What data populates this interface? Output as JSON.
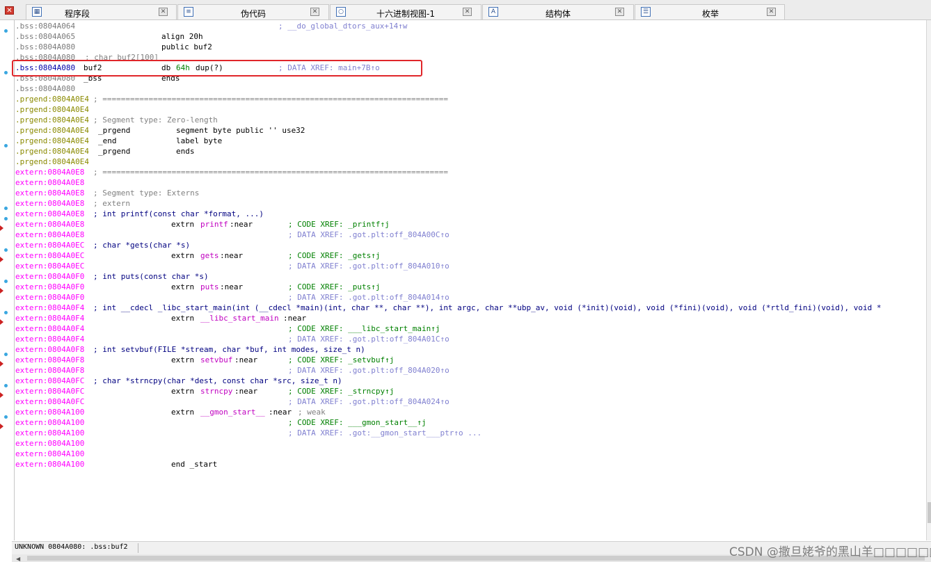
{
  "tabs": [
    {
      "label": "程序段",
      "icon": "program-segment-icon"
    },
    {
      "label": "伪代码",
      "icon": "pseudocode-icon"
    },
    {
      "label": "十六进制视图-1",
      "icon": "hex-view-icon"
    },
    {
      "label": "结构体",
      "icon": "structures-icon"
    },
    {
      "label": "枚举",
      "icon": "enums-icon"
    }
  ],
  "lines": [
    {
      "seg": "bss",
      "addr": ".bss:0804A064",
      "parts": [
        {
          "t": "; __do_global_dtors_aux+14↑w",
          "cls": "cmt-b",
          "col": 378
        }
      ]
    },
    {
      "seg": "bss",
      "addr": ".bss:0804A065",
      "parts": [
        {
          "t": "align 20h",
          "cls": "blk2",
          "col": 210
        }
      ]
    },
    {
      "seg": "bss",
      "addr": ".bss:0804A080",
      "parts": [
        {
          "t": "public buf2",
          "cls": "blk2",
          "col": 210
        }
      ]
    },
    {
      "seg": "bss",
      "addr": ".bss:0804A080",
      "parts": [
        {
          "t": "; char buf2[100]",
          "cls": "cmt",
          "col": 100
        }
      ]
    },
    {
      "seg": "bss-hl",
      "addr": ".bss:0804A080",
      "parts": [
        {
          "t": "buf2",
          "cls": "blk2",
          "col": 98
        },
        {
          "t": "db",
          "cls": "blk2",
          "col": 210
        },
        {
          "t": "64h",
          "cls": "num",
          "col": 231
        },
        {
          "t": "dup(?)",
          "cls": "blk2",
          "col": 259
        },
        {
          "t": "; DATA XREF: main+7B↑o",
          "cls": "cmt-b",
          "col": 378
        }
      ]
    },
    {
      "seg": "bss",
      "addr": ".bss:0804A080",
      "parts": [
        {
          "t": "_bss",
          "cls": "blk2",
          "col": 98
        },
        {
          "t": "ends",
          "cls": "blk2",
          "col": 210
        }
      ]
    },
    {
      "seg": "bss",
      "addr": ".bss:0804A080",
      "parts": []
    },
    {
      "seg": "prg",
      "addr": ".prgend:0804A0E4",
      "parts": [
        {
          "t": "; ===========================================================================",
          "cls": "cmt",
          "col": 112
        }
      ]
    },
    {
      "seg": "prg",
      "addr": ".prgend:0804A0E4",
      "parts": []
    },
    {
      "seg": "prg",
      "addr": ".prgend:0804A0E4",
      "parts": [
        {
          "t": "; Segment type: Zero-length",
          "cls": "cmt",
          "col": 112
        }
      ]
    },
    {
      "seg": "prg",
      "addr": ".prgend:0804A0E4",
      "parts": [
        {
          "t": "_prgend",
          "cls": "blk2",
          "col": 119
        },
        {
          "t": "segment byte public '' use32",
          "cls": "blk2",
          "col": 231
        }
      ]
    },
    {
      "seg": "prg",
      "addr": ".prgend:0804A0E4",
      "parts": [
        {
          "t": "_end",
          "cls": "blk2",
          "col": 119
        },
        {
          "t": "label byte",
          "cls": "blk2",
          "col": 231
        }
      ]
    },
    {
      "seg": "prg",
      "addr": ".prgend:0804A0E4",
      "parts": [
        {
          "t": "_prgend",
          "cls": "blk2",
          "col": 119
        },
        {
          "t": "ends",
          "cls": "blk2",
          "col": 231
        }
      ]
    },
    {
      "seg": "prg",
      "addr": ".prgend:0804A0E4",
      "parts": []
    },
    {
      "seg": "ext",
      "addr": "extern:0804A0E8",
      "parts": [
        {
          "t": "; ===========================================================================",
          "cls": "cmt",
          "col": 112
        }
      ]
    },
    {
      "seg": "ext",
      "addr": "extern:0804A0E8",
      "parts": []
    },
    {
      "seg": "ext",
      "addr": "extern:0804A0E8",
      "parts": [
        {
          "t": "; Segment type: Externs",
          "cls": "cmt",
          "col": 112
        }
      ]
    },
    {
      "seg": "ext",
      "addr": "extern:0804A0E8",
      "parts": [
        {
          "t": "; extern",
          "cls": "cmt",
          "col": 112
        }
      ]
    },
    {
      "seg": "ext",
      "addr": "extern:0804A0E8",
      "parts": [
        {
          "t": "; int printf(const char *format, ...)",
          "cls": "sig",
          "col": 112
        }
      ]
    },
    {
      "seg": "ext",
      "addr": "extern:0804A0E8",
      "parts": [
        {
          "t": "extrn",
          "cls": "blk2",
          "col": 224
        },
        {
          "t": "printf",
          "cls": "fnp",
          "col": 266
        },
        {
          "t": ":near",
          "cls": "blk2",
          "col": 308
        },
        {
          "t": "; CODE XREF: _printf↑j",
          "cls": "code-x",
          "col": 392
        }
      ]
    },
    {
      "seg": "ext",
      "addr": "extern:0804A0E8",
      "parts": [
        {
          "t": "; DATA XREF: .got.plt:off_804A00C↑o",
          "cls": "cmt-b",
          "col": 392
        }
      ]
    },
    {
      "seg": "ext",
      "addr": "extern:0804A0EC",
      "parts": [
        {
          "t": "; char *gets(char *s)",
          "cls": "sig",
          "col": 112
        }
      ]
    },
    {
      "seg": "ext",
      "addr": "extern:0804A0EC",
      "parts": [
        {
          "t": "extrn",
          "cls": "blk2",
          "col": 224
        },
        {
          "t": "gets",
          "cls": "fnp",
          "col": 266
        },
        {
          "t": ":near",
          "cls": "blk2",
          "col": 294
        },
        {
          "t": "; CODE XREF: _gets↑j",
          "cls": "code-x",
          "col": 392
        }
      ]
    },
    {
      "seg": "ext",
      "addr": "extern:0804A0EC",
      "parts": [
        {
          "t": "; DATA XREF: .got.plt:off_804A010↑o",
          "cls": "cmt-b",
          "col": 392
        }
      ]
    },
    {
      "seg": "ext",
      "addr": "extern:0804A0F0",
      "parts": [
        {
          "t": "; int puts(const char *s)",
          "cls": "sig",
          "col": 112
        }
      ]
    },
    {
      "seg": "ext",
      "addr": "extern:0804A0F0",
      "parts": [
        {
          "t": "extrn",
          "cls": "blk2",
          "col": 224
        },
        {
          "t": "puts",
          "cls": "fnp",
          "col": 266
        },
        {
          "t": ":near",
          "cls": "blk2",
          "col": 294
        },
        {
          "t": "; CODE XREF: _puts↑j",
          "cls": "code-x",
          "col": 392
        }
      ]
    },
    {
      "seg": "ext",
      "addr": "extern:0804A0F0",
      "parts": [
        {
          "t": "; DATA XREF: .got.plt:off_804A014↑o",
          "cls": "cmt-b",
          "col": 392
        }
      ]
    },
    {
      "seg": "ext",
      "addr": "extern:0804A0F4",
      "parts": [
        {
          "t": "; int __cdecl _libc_start_main(int (__cdecl *main)(int, char **, char **), int argc, char **ubp_av, void (*init)(void), void (*fini)(void), void (*rtld_fini)(void), void *",
          "cls": "sig",
          "col": 112
        }
      ]
    },
    {
      "seg": "ext",
      "addr": "extern:0804A0F4",
      "parts": [
        {
          "t": "extrn",
          "cls": "blk2",
          "col": 224
        },
        {
          "t": "__libc_start_main",
          "cls": "fnp",
          "col": 266
        },
        {
          "t": ":near",
          "cls": "blk2",
          "col": 385
        }
      ]
    },
    {
      "seg": "ext",
      "addr": "extern:0804A0F4",
      "parts": [
        {
          "t": "; CODE XREF: ___libc_start_main↑j",
          "cls": "code-x",
          "col": 392
        }
      ]
    },
    {
      "seg": "ext",
      "addr": "extern:0804A0F4",
      "parts": [
        {
          "t": "; DATA XREF: .got.plt:off_804A01C↑o",
          "cls": "cmt-b",
          "col": 392
        }
      ]
    },
    {
      "seg": "ext",
      "addr": "extern:0804A0F8",
      "parts": [
        {
          "t": "; int setvbuf(FILE *stream, char *buf, int modes, size_t n)",
          "cls": "sig",
          "col": 112
        }
      ]
    },
    {
      "seg": "ext",
      "addr": "extern:0804A0F8",
      "parts": [
        {
          "t": "extrn",
          "cls": "blk2",
          "col": 224
        },
        {
          "t": "setvbuf",
          "cls": "fnp",
          "col": 266
        },
        {
          "t": ":near",
          "cls": "blk2",
          "col": 315
        },
        {
          "t": "; CODE XREF: _setvbuf↑j",
          "cls": "code-x",
          "col": 392
        }
      ]
    },
    {
      "seg": "ext",
      "addr": "extern:0804A0F8",
      "parts": [
        {
          "t": "; DATA XREF: .got.plt:off_804A020↑o",
          "cls": "cmt-b",
          "col": 392
        }
      ]
    },
    {
      "seg": "ext",
      "addr": "extern:0804A0FC",
      "parts": [
        {
          "t": "; char *strncpy(char *dest, const char *src, size_t n)",
          "cls": "sig",
          "col": 112
        }
      ]
    },
    {
      "seg": "ext",
      "addr": "extern:0804A0FC",
      "parts": [
        {
          "t": "extrn",
          "cls": "blk2",
          "col": 224
        },
        {
          "t": "strncpy",
          "cls": "fnp",
          "col": 266
        },
        {
          "t": ":near",
          "cls": "blk2",
          "col": 315
        },
        {
          "t": "; CODE XREF: _strncpy↑j",
          "cls": "code-x",
          "col": 392
        }
      ]
    },
    {
      "seg": "ext",
      "addr": "extern:0804A0FC",
      "parts": [
        {
          "t": "; DATA XREF: .got.plt:off_804A024↑o",
          "cls": "cmt-b",
          "col": 392
        }
      ]
    },
    {
      "seg": "ext",
      "addr": "extern:0804A100",
      "parts": [
        {
          "t": "extrn",
          "cls": "blk2",
          "col": 224
        },
        {
          "t": "__gmon_start__",
          "cls": "fnp",
          "col": 266
        },
        {
          "t": ":near",
          "cls": "blk2",
          "col": 364
        },
        {
          "t": "; weak",
          "cls": "cmt",
          "col": 406
        }
      ]
    },
    {
      "seg": "ext",
      "addr": "extern:0804A100",
      "parts": [
        {
          "t": "; CODE XREF: ___gmon_start__↑j",
          "cls": "code-x",
          "col": 392
        }
      ]
    },
    {
      "seg": "ext",
      "addr": "extern:0804A100",
      "parts": [
        {
          "t": "; DATA XREF: .got:__gmon_start___ptr↑o ...",
          "cls": "cmt-b",
          "col": 392
        }
      ]
    },
    {
      "seg": "ext",
      "addr": "extern:0804A100",
      "parts": []
    },
    {
      "seg": "ext",
      "addr": "extern:0804A100",
      "parts": []
    },
    {
      "seg": "ext",
      "addr": "extern:0804A100",
      "parts": [
        {
          "t": "end _start",
          "cls": "blk2",
          "col": 224
        }
      ]
    }
  ],
  "gutter_dots_rows": [
    0,
    4,
    11,
    17,
    18,
    21,
    24,
    27,
    31,
    34,
    37
  ],
  "gutter_arrows_rows": [
    19,
    22,
    25,
    28,
    32,
    35,
    38
  ],
  "status": {
    "text": "UNKNOWN 0804A080: .bss:buf2"
  },
  "watermark": "CSDN @撒旦姥爷的黑山羊□□□□□□",
  "colors": {
    "highlight_box": "#e0262a",
    "extern_addr": "#ff00ff",
    "prgend_addr": "#8a8a00",
    "bss_addr": "#7a7a7a"
  }
}
